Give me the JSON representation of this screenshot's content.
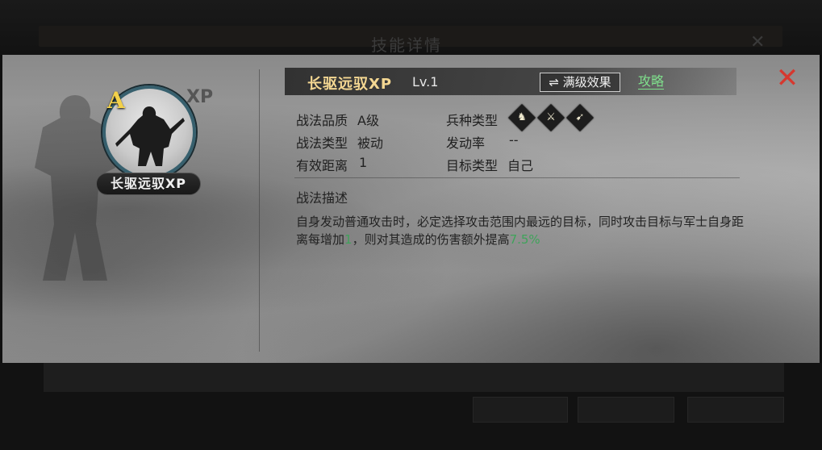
{
  "background": {
    "title": "技能详情"
  },
  "portrait": {
    "grade": "A",
    "xp_tag": "XP",
    "name": "长驱远驭XP"
  },
  "header": {
    "skill_name": "长驱远驭XP",
    "level": "Lv.1",
    "max_effect_icon": "swap-icon",
    "max_effect_label": "满级效果",
    "guide_label": "攻略",
    "close_icon": "close-icon"
  },
  "attributes": {
    "quality_label": "战法品质",
    "quality_value": "A级",
    "type_label": "战法类型",
    "type_value": "被动",
    "range_label": "有效距离",
    "range_value": "1",
    "unit_label": "兵种类型",
    "unit_icons": [
      "cavalry-icon",
      "infantry-icon",
      "archer-icon"
    ],
    "rate_label": "发动率",
    "rate_value": "--",
    "target_label": "目标类型",
    "target_value": "自己"
  },
  "description": {
    "title": "战法描述",
    "part1": "自身发动普通攻击时，必定选择攻击范围内最远的目标，同时攻击目标与军士自身距离每增加",
    "hl1": "1",
    "part2": "，则对其造成的伤害额外提高",
    "hl2": "7.5%"
  },
  "colors": {
    "accent_gold": "#f4d792",
    "grade_gold": "#f3d14a",
    "link_green": "#7fe08c",
    "highlight_green": "#3fa35a",
    "close_red": "#d6382f"
  }
}
